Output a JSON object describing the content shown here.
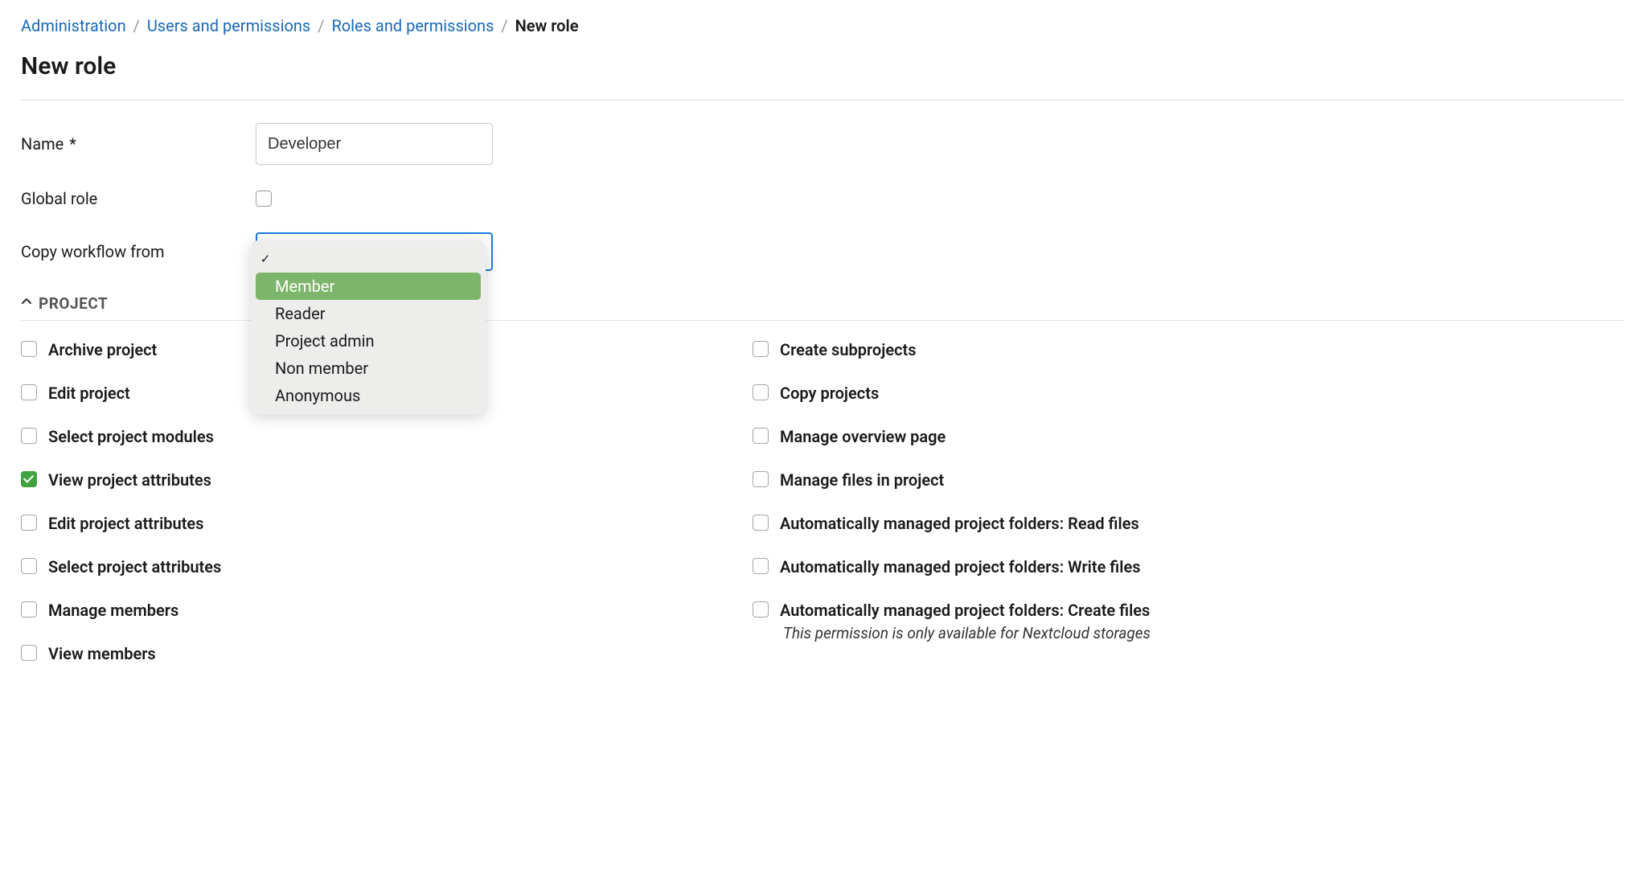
{
  "breadcrumb": {
    "items": [
      {
        "label": "Administration"
      },
      {
        "label": "Users and permissions"
      },
      {
        "label": "Roles and permissions"
      }
    ],
    "current": "New role"
  },
  "page_title": "New role",
  "form": {
    "name_label": "Name",
    "name_required": "*",
    "name_value": "Developer",
    "global_role_label": "Global role",
    "global_role_checked": false,
    "copy_workflow_label": "Copy workflow from",
    "dropdown": {
      "selected": "",
      "options": [
        {
          "label": "",
          "checked": true,
          "highlight": false
        },
        {
          "label": "Member",
          "checked": false,
          "highlight": true
        },
        {
          "label": "Reader",
          "checked": false,
          "highlight": false
        },
        {
          "label": "Project admin",
          "checked": false,
          "highlight": false
        },
        {
          "label": "Non member",
          "checked": false,
          "highlight": false
        },
        {
          "label": "Anonymous",
          "checked": false,
          "highlight": false
        }
      ]
    }
  },
  "section": {
    "title": "PROJECT"
  },
  "permissions": {
    "left": [
      {
        "label": "Archive project",
        "checked": false
      },
      {
        "label": "Edit project",
        "checked": false
      },
      {
        "label": "Select project modules",
        "checked": false
      },
      {
        "label": "View project attributes",
        "checked": true
      },
      {
        "label": "Edit project attributes",
        "checked": false
      },
      {
        "label": "Select project attributes",
        "checked": false
      },
      {
        "label": "Manage members",
        "checked": false
      },
      {
        "label": "View members",
        "checked": false
      }
    ],
    "right": [
      {
        "label": "Create subprojects",
        "checked": false
      },
      {
        "label": "Copy projects",
        "checked": false
      },
      {
        "label": "Manage overview page",
        "checked": false
      },
      {
        "label": "Manage files in project",
        "checked": false
      },
      {
        "label": "Automatically managed project folders: Read files",
        "checked": false
      },
      {
        "label": "Automatically managed project folders: Write files",
        "checked": false
      },
      {
        "label": "Automatically managed project folders: Create files",
        "checked": false,
        "note": "This permission is only available for Nextcloud storages"
      }
    ]
  }
}
